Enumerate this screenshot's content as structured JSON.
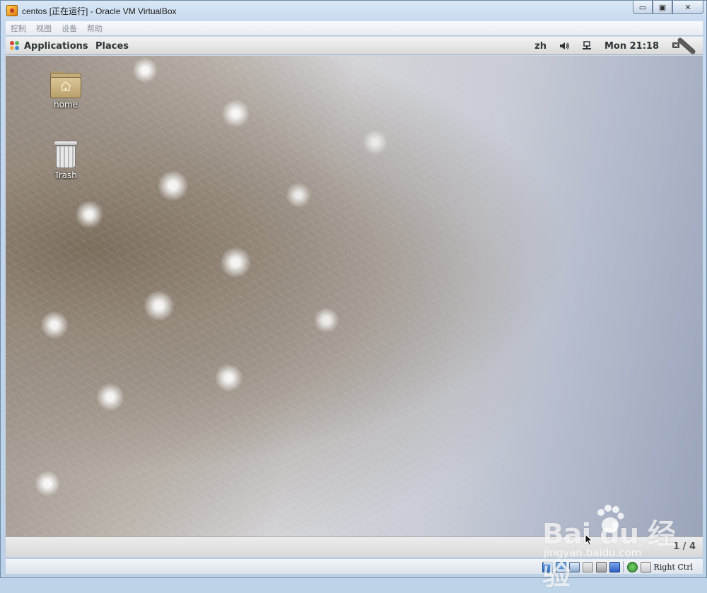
{
  "window": {
    "title": "centos [正在运行] - Oracle VM VirtualBox",
    "minimize_glyph": "▭",
    "restore_glyph": "▣",
    "close_glyph": "✕"
  },
  "vbox_menu": {
    "items": [
      "控制",
      "视图",
      "设备",
      "帮助"
    ]
  },
  "gnome_panel": {
    "applications_label": "Applications",
    "places_label": "Places",
    "language": "zh",
    "clock": "Mon 21:18"
  },
  "desktop": {
    "icons": [
      {
        "label": "home",
        "icon": "home-folder-icon"
      },
      {
        "label": "Trash",
        "icon": "trash-icon"
      }
    ]
  },
  "bottom_panel": {
    "workspace": "1 / 4"
  },
  "vbox_status": {
    "host_key": "Right Ctrl",
    "icons": [
      "hard-disk-icon",
      "optical-drive-icon",
      "network-icon",
      "usb-icon",
      "shared-folders-icon",
      "display-icon",
      "video-capture-icon",
      "mouse-integration-icon",
      "keyboard-icon"
    ]
  },
  "watermark": {
    "logo_text": "Bai  du 经验",
    "url": "jingyan.baidu.com"
  }
}
